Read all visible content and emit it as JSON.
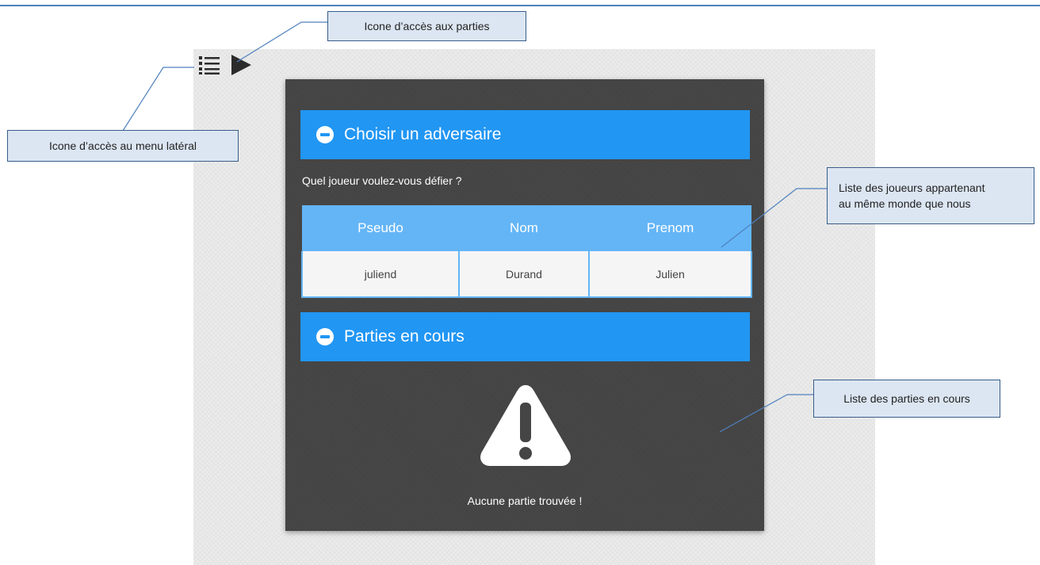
{
  "sections": {
    "opponent": {
      "title": "Choisir un adversaire",
      "prompt": "Quel joueur voulez-vous défier ?"
    },
    "games": {
      "title": "Parties en cours",
      "empty_message": "Aucune partie trouvée !"
    }
  },
  "players_table": {
    "headers": [
      "Pseudo",
      "Nom",
      "Prenom"
    ],
    "rows": [
      {
        "pseudo": "juliend",
        "nom": "Durand",
        "prenom": "Julien"
      }
    ]
  },
  "annotations": {
    "games_icon": "Icone d’accès aux parties",
    "menu_icon": "Icone d’accès au menu latéral",
    "players_list_line1": "Liste des joueurs appartenant",
    "players_list_line2": "au même monde que nous",
    "games_list": "Liste des parties en cours"
  },
  "icons": {
    "menu": "list-menu-icon",
    "games": "play-icon",
    "section_toggle": "minus-circle-icon",
    "empty": "warning-icon"
  },
  "colors": {
    "accent": "#2196f3",
    "table_header": "#64b5f6",
    "panel": "#454545",
    "callout_fill": "#dce6f2",
    "callout_border": "#385d8a"
  }
}
